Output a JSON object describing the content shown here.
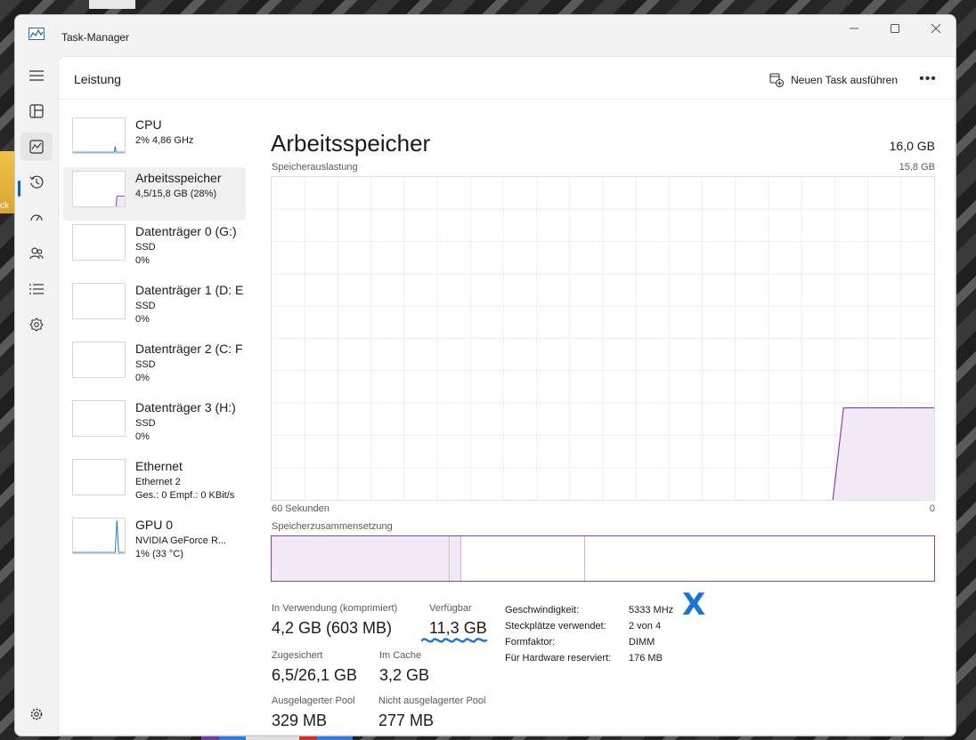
{
  "window": {
    "title": "Task-Manager"
  },
  "icons": {
    "app": "performance-chart-icon",
    "minimize": "minimize-icon",
    "maximize": "maximize-icon",
    "close": "close-icon",
    "hamburger": "hamburger-menu-icon",
    "processes": "processes-icon",
    "performance": "performance-icon",
    "history": "app-history-icon",
    "startup": "startup-apps-icon",
    "users": "users-icon",
    "details": "details-icon",
    "services": "services-icon",
    "settings": "settings-icon",
    "run_task": "run-new-task-icon",
    "more": "more-options-icon"
  },
  "desktop": {
    "partial_label": "ck"
  },
  "header": {
    "title": "Leistung",
    "run_task_label": "Neuen Task ausführen",
    "more_label": "•••"
  },
  "resources": [
    {
      "name": "CPU",
      "line1": "2% 4,86 GHz",
      "line2": ""
    },
    {
      "name": "Arbeitsspeicher",
      "line1": "4,5/15,8 GB (28%)",
      "line2": ""
    },
    {
      "name": "Datenträger 0 (G:)",
      "line1": "SSD",
      "line2": "0%"
    },
    {
      "name": "Datenträger 1 (D: E",
      "line1": "SSD",
      "line2": "0%"
    },
    {
      "name": "Datenträger 2 (C: F",
      "line1": "SSD",
      "line2": "0%"
    },
    {
      "name": "Datenträger 3 (H:)",
      "line1": "SSD",
      "line2": "0%"
    },
    {
      "name": "Ethernet",
      "line1": "Ethernet 2",
      "line2": "Ges.: 0 Empf.: 0 KBit/s"
    },
    {
      "name": "GPU 0",
      "line1": "NVIDIA GeForce R...",
      "line2": "1% (33 °C)"
    }
  ],
  "memory": {
    "title": "Arbeitsspeicher",
    "total": "16,0 GB",
    "usage_label": "Speicherauslastung",
    "usage_max": "15,8 GB",
    "x_left": "60 Sekunden",
    "x_right": "0",
    "composition_label": "Speicherzusammensetzung",
    "stats": {
      "in_use_label": "In Verwendung (komprimiert)",
      "in_use_value": "4,2 GB (603 MB)",
      "available_label": "Verfügbar",
      "available_value": "11,3 GB",
      "committed_label": "Zugesichert",
      "committed_value": "6,5/26,1 GB",
      "cached_label": "Im Cache",
      "cached_value": "3,2 GB",
      "paged_label": "Ausgelagerter Pool",
      "paged_value": "329 MB",
      "nonpaged_label": "Nicht ausgelagerter Pool",
      "nonpaged_value": "277 MB"
    },
    "specs": {
      "speed_label": "Geschwindigkeit:",
      "speed_value": "5333 MHz",
      "slots_label": "Steckplätze verwendet:",
      "slots_value": "2 von 4",
      "form_label": "Formfaktor:",
      "form_value": "DIMM",
      "reserved_label": "Für Hardware reserviert:",
      "reserved_value": "176 MB"
    }
  },
  "colors": {
    "memory_line": "#8b3fb3",
    "memory_fill": "#f1eaf4",
    "accent": "#0067c0",
    "annotation": "#1a73d8"
  },
  "annotations": {
    "cross": "X"
  }
}
